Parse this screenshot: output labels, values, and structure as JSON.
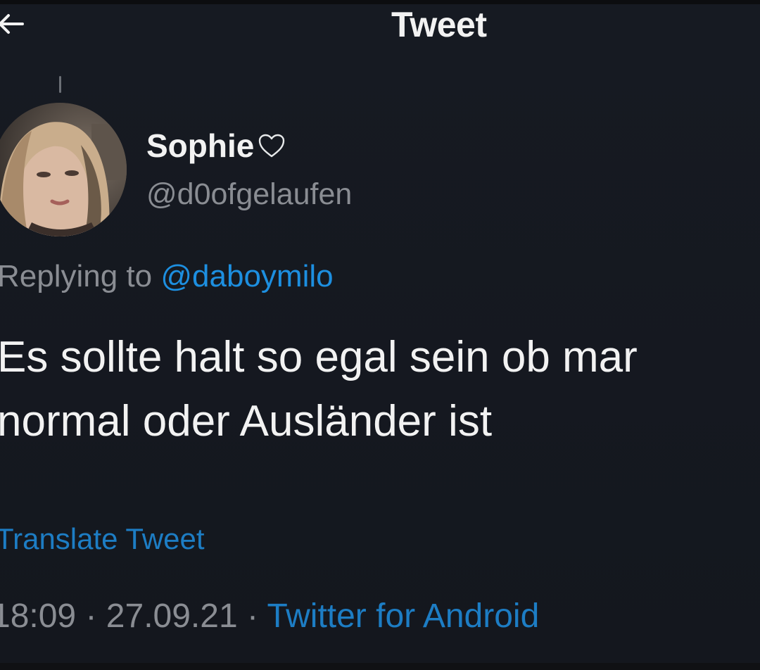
{
  "header": {
    "title": "Tweet",
    "back_icon": "arrow-left-icon"
  },
  "author": {
    "name": "Sophie",
    "heart_icon": "heart-outline-icon",
    "handle": "@d0ofgelaufen"
  },
  "reply": {
    "prefix": "Replying to",
    "mention": "@daboymilo"
  },
  "tweet": {
    "line1": "Es sollte halt so egal sein ob mar",
    "line2": "normal oder Ausländer ist"
  },
  "translate_label": "Translate Tweet",
  "meta": {
    "time": "18:09",
    "separator": "·",
    "date": "27.09.21",
    "source": "Twitter for Android"
  },
  "colors": {
    "background": "#15181f",
    "link": "#1d8fe0",
    "secondary_text": "#8a8d93"
  }
}
